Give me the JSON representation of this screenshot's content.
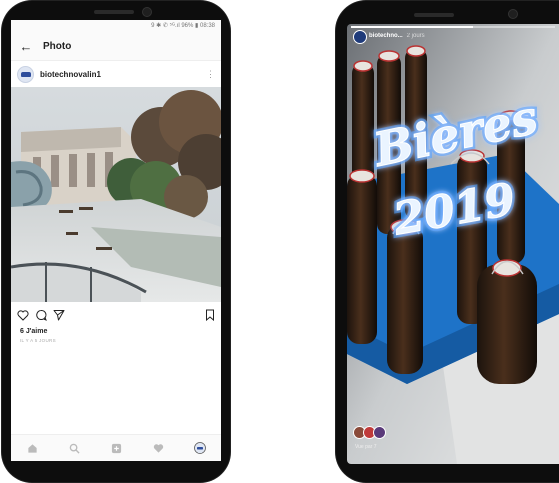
{
  "left_phone": {
    "status_bar": {
      "text": "9 ✱ ✆ ⁵ᴳ.ıl 96% ▮ 08:38"
    },
    "header": {
      "title": "Photo",
      "back_icon": "arrow-left-icon"
    },
    "post": {
      "username": "biotechnovalin1",
      "likes": "6 J'aime",
      "time_ago": "IL Y A 5 JOURS"
    },
    "nav_icons": [
      "home-icon",
      "search-icon",
      "add-icon",
      "heart-icon",
      "profile-icon"
    ]
  },
  "right_phone": {
    "story": {
      "username": "biotechno...",
      "time_ago": "2 jours",
      "overlay_text_line1": "Bières",
      "overlay_text_line2": "2019",
      "seen_by": "Vue par 7",
      "progress": 0.6
    },
    "colors": {
      "crate": "#1e73c8",
      "neon": "#cfe6ff"
    }
  }
}
